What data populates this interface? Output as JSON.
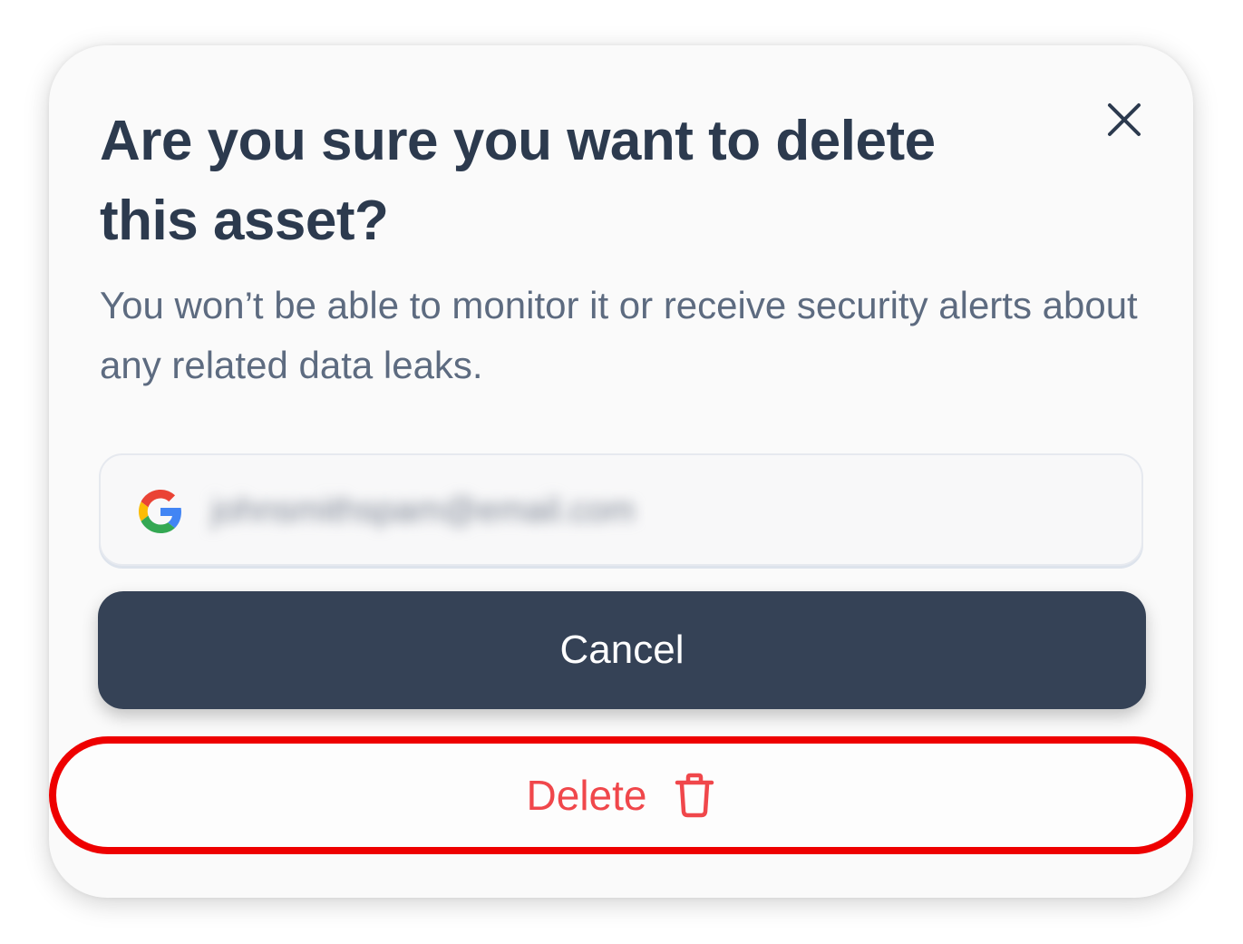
{
  "dialog": {
    "title": "Are you sure you want to delete this asset?",
    "subtitle": "You won’t be able to monitor it or receive security alerts about any related data leaks.",
    "close_icon": "close-icon"
  },
  "asset": {
    "provider_icon": "google-icon",
    "email": "johnsmithspam@email.com"
  },
  "actions": {
    "cancel_label": "Cancel",
    "delete_label": "Delete",
    "delete_icon": "trash-icon"
  },
  "colors": {
    "title": "#2c3a4e",
    "subtitle": "#5d6b80",
    "cancel_bg": "#354256",
    "delete_text": "#f0474b",
    "highlight_outline": "#ee0000"
  }
}
